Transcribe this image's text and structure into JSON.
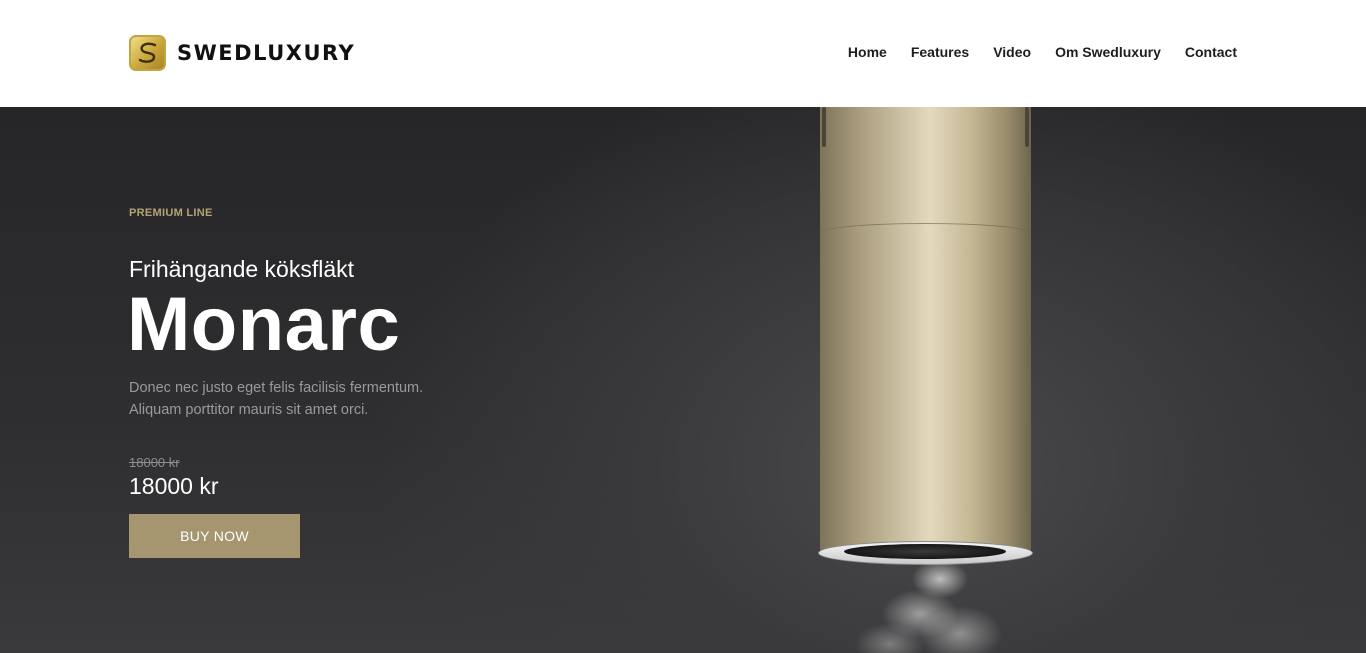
{
  "brand": {
    "name": "SWEDLUXURY",
    "logo_icon": "s-monogram-icon"
  },
  "nav": {
    "items": [
      {
        "label": "Home"
      },
      {
        "label": "Features"
      },
      {
        "label": "Video"
      },
      {
        "label": "Om Swedluxury"
      },
      {
        "label": "Contact"
      }
    ]
  },
  "hero": {
    "eyebrow": "PREMIUM LINE",
    "subtitle": "Frihängande köksfläkt",
    "title": "Monarc",
    "description": "Donec nec justo eget felis facilisis fermentum. Aliquam porttitor mauris sit amet orci.",
    "old_price": "18000 kr",
    "price": "18000 kr",
    "buy_label": "BUY NOW",
    "product_image": "cylindrical-brass-cooker-hood-with-steam"
  },
  "colors": {
    "accent_gold": "#a59670",
    "eyebrow_gold": "#b6a274",
    "hero_background": "#2b2b2d",
    "header_background": "#ffffff"
  }
}
